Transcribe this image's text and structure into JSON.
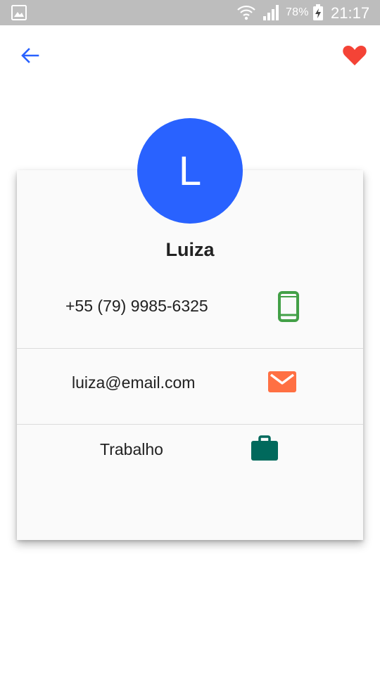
{
  "status_bar": {
    "battery_percent": "78%",
    "time": "21:17",
    "icons": [
      "gallery-icon",
      "wifi-icon",
      "signal-icon",
      "battery-charging-icon"
    ]
  },
  "top_bar": {
    "back_icon": "arrow-back-icon",
    "favorite_icon": "heart-icon"
  },
  "contact": {
    "initial": "L",
    "name": "Luiza",
    "phone": "+55 (79) 9985-6325",
    "email": "luiza@email.com",
    "category": "Trabalho"
  },
  "colors": {
    "accent_blue": "#2962ff",
    "favorite_red": "#f44336",
    "phone_green": "#43a047",
    "email_orange": "#ff7043",
    "work_teal": "#00695c",
    "status_bar": "#bdbdbd"
  }
}
